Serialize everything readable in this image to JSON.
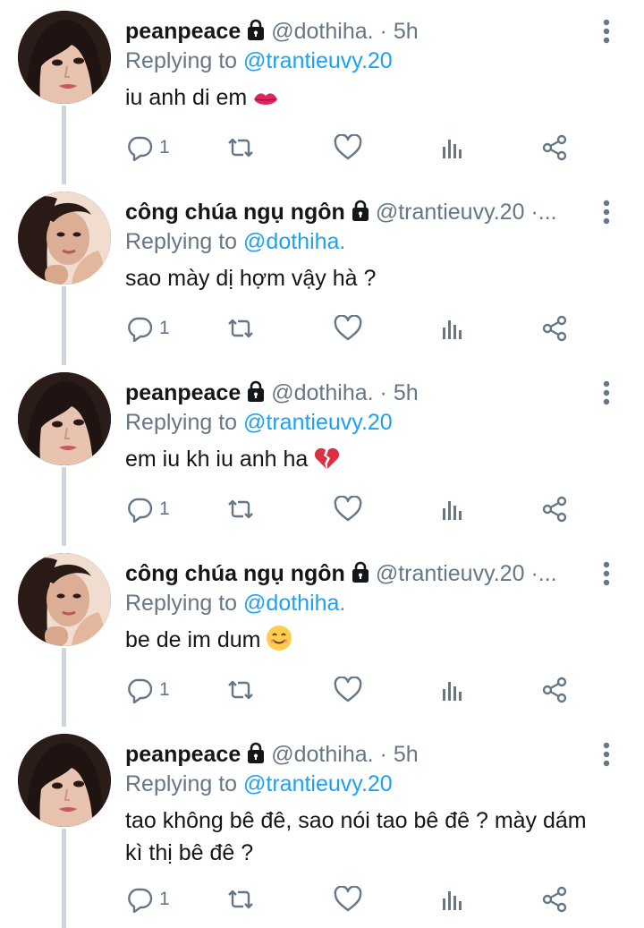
{
  "colors": {
    "name": "#14171a",
    "secondary": "#657786",
    "link": "#1da1f2",
    "thread_line": "#ccd6dd"
  },
  "tweets": [
    {
      "name": "peanpeace",
      "handle": "@dothiha.",
      "dot": "·",
      "time": "5h",
      "replying_prefix": "Replying to",
      "replying_to": "@trantieuvy.20",
      "text": "iu anh di em",
      "emoji": "lips-icon",
      "reply_count": "1"
    },
    {
      "name": "công chúa ngụ ngôn",
      "handle": "@trantieuvy.20",
      "dot": "·...",
      "time": "",
      "replying_prefix": "Replying to",
      "replying_to": "@dothiha.",
      "text": "sao mày dị hợm vậy hà ?",
      "emoji": "",
      "reply_count": "1"
    },
    {
      "name": "peanpeace",
      "handle": "@dothiha.",
      "dot": "·",
      "time": "5h",
      "replying_prefix": "Replying to",
      "replying_to": "@trantieuvy.20",
      "text": "em iu kh iu anh ha",
      "emoji": "broken-heart-icon",
      "reply_count": "1"
    },
    {
      "name": "công chúa ngụ ngôn",
      "handle": "@trantieuvy.20",
      "dot": "·...",
      "time": "",
      "replying_prefix": "Replying to",
      "replying_to": "@dothiha.",
      "text": "be de im dum",
      "emoji": "smiling-face-icon",
      "reply_count": "1"
    },
    {
      "name": "peanpeace",
      "handle": "@dothiha.",
      "dot": "·",
      "time": "5h",
      "replying_prefix": "Replying to",
      "replying_to": "@trantieuvy.20",
      "text": "tao không bê đê, sao nói tao bê đê ? mày dám kì thị bê đê ?",
      "emoji": "",
      "reply_count": "1"
    }
  ]
}
